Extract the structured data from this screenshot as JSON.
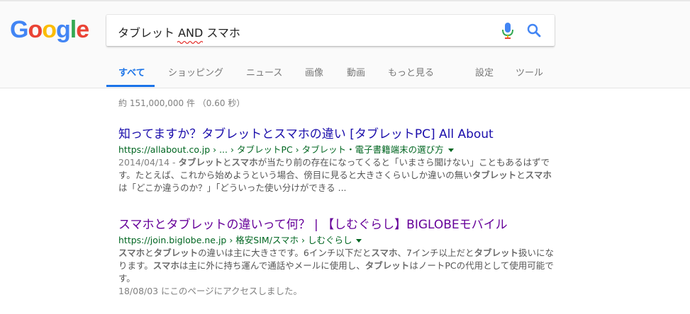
{
  "logo": {
    "letters": [
      "G",
      "o",
      "o",
      "g",
      "l",
      "e"
    ],
    "colors": [
      "#4285F4",
      "#EA4335",
      "#FBBC05",
      "#4285F4",
      "#34A853",
      "#EA4335"
    ]
  },
  "search": {
    "query": "タブレット AND スマホ"
  },
  "tabs": [
    {
      "label": "すべて",
      "active": true
    },
    {
      "label": "ショッピング"
    },
    {
      "label": "ニュース"
    },
    {
      "label": "画像"
    },
    {
      "label": "動画"
    },
    {
      "label": "もっと見る"
    },
    {
      "label": "設定"
    },
    {
      "label": "ツール"
    }
  ],
  "stats": "約 151,000,000 件 （0.60 秒）",
  "results": [
    {
      "title": "知ってますか？タブレットとスマホの違い [タブレットPC] All About",
      "url": "https://allabout.co.jp › ... › タブレットPC › タブレット・電子書籍端末の選び方",
      "date": "2014/04/14 - ",
      "snippet_parts": [
        {
          "b": "タブレット"
        },
        {
          "t": "と"
        },
        {
          "b": "スマホ"
        },
        {
          "t": "が当たり前の存在になってくると「いまさら聞けない」こともあるはずです。たとえば、これから始めようという場合、傍目に見ると大きさくらいしか違いの無い"
        },
        {
          "b": "タブレット"
        },
        {
          "t": "と"
        },
        {
          "b": "スマホ"
        },
        {
          "t": "は「どこか違うのか？」「どういった使い分けができる ..."
        }
      ]
    },
    {
      "title": "スマホとタブレットの違いって何？ | 【しむぐらし】BIGLOBEモバイル",
      "url": "https://join.biglobe.ne.jp › 格安SIM/スマホ › しむぐらし",
      "snippet_parts": [
        {
          "b": "スマホ"
        },
        {
          "t": "と"
        },
        {
          "b": "タブレット"
        },
        {
          "t": "の違いは主に大きさです。6インチ以下だと"
        },
        {
          "b": "スマホ"
        },
        {
          "t": "、7インチ以上だと"
        },
        {
          "b": "タブレット"
        },
        {
          "t": "扱いになります。"
        },
        {
          "b": "スマホ"
        },
        {
          "t": "は主に外に持ち運んで通話やメールに使用し、"
        },
        {
          "b": "タブレット"
        },
        {
          "t": "はノートPCの代用として使用可能です。"
        }
      ],
      "visited_note": "18/08/03 にこのページにアクセスしました。"
    }
  ]
}
